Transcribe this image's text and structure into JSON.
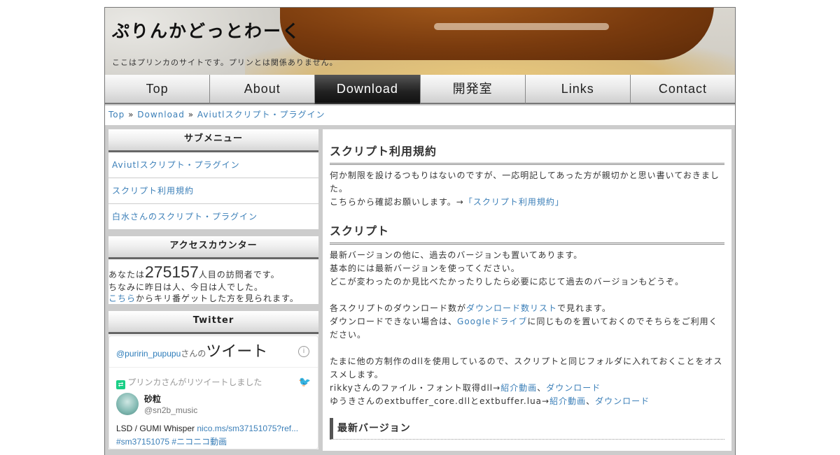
{
  "header": {
    "site_title": "ぷりんかどっとわーく",
    "site_description": "ここはプリンカのサイトです。プリンとは関係ありません。"
  },
  "nav": {
    "items": [
      {
        "label": "Top"
      },
      {
        "label": "About"
      },
      {
        "label": "Download",
        "active": true
      },
      {
        "label": "開発室"
      },
      {
        "label": "Links"
      },
      {
        "label": "Contact"
      }
    ]
  },
  "breadcrumb": {
    "items": [
      "Top",
      "Download",
      "Aviutlスクリプト・プラグイン"
    ],
    "separator": "»"
  },
  "sidebar": {
    "submenu_title": "サブメニュー",
    "submenu_items": [
      {
        "label": "Aviutlスクリプト・プラグイン"
      },
      {
        "label": "スクリプト利用規約"
      },
      {
        "label": "白水さんのスクリプト・プラグイン"
      }
    ],
    "counter_title": "アクセスカウンター",
    "counter_prefix": "あなたは",
    "counter_value": "275157",
    "counter_suffix": "人目の訪問者です。",
    "counter_line2": "ちなみに昨日は人、今日は人でした。",
    "counter_link": "こちら",
    "counter_line3": "からキリ番ゲットした方を見られます。",
    "twitter_title": "Twitter",
    "twitter": {
      "handle": "@puririn_pupupu",
      "san_no": "さんの",
      "tweets_label": "ツイート",
      "retweet_note": "プリンカさんがリツイートしました",
      "user_name": "砂粒",
      "user_handle": "@sn2b_music",
      "tweet_text": "LSD / GUMI Whisper ",
      "tweet_link": "nico.ms/sm37151075?ref...",
      "tweet_tags": "#sm37151075 #ニコニコ動画"
    }
  },
  "main": {
    "section1_title": "スクリプト利用規約",
    "section1_p1": "何か制限を設けるつもりはないのですが、一応明記してあった方が親切かと思い書いておきました。",
    "section1_p2_prefix": "こちらから確認お願いします。→",
    "section1_p2_link": "「スクリプト利用規約」",
    "section2_title": "スクリプト",
    "section2_l1": "最新バージョンの他に、過去のバージョンも置いてあります。",
    "section2_l2": "基本的には最新バージョンを使ってください。",
    "section2_l3": "どこが変わったのか見比べたかったりしたら必要に応じて過去のバージョンもどうぞ。",
    "section2_l4_prefix": "各スクリプトのダウンロード数が",
    "section2_l4_link": "ダウンロード数リスト",
    "section2_l4_suffix": "で見れます。",
    "section2_l5_prefix": "ダウンロードできない場合は、",
    "section2_l5_link": "Googleドライブ",
    "section2_l5_suffix": "に同じものを置いておくのでそちらをご利用ください。",
    "section2_l6": "たまに他の方制作のdllを使用しているので、スクリプトと同じフォルダに入れておくことをオススメします。",
    "section2_l7_prefix": "rikkyさんのファイル・フォント取得dll→",
    "section2_l7_link1": "紹介動画",
    "comma": "、",
    "section2_l7_link2": "ダウンロード",
    "section2_l8_prefix": "ゆうきさんのextbuffer_core.dllとextbuffer.lua→",
    "section2_l8_link1": "紹介動画",
    "section2_l8_link2": "ダウンロード",
    "section3_title": "最新バージョン"
  }
}
